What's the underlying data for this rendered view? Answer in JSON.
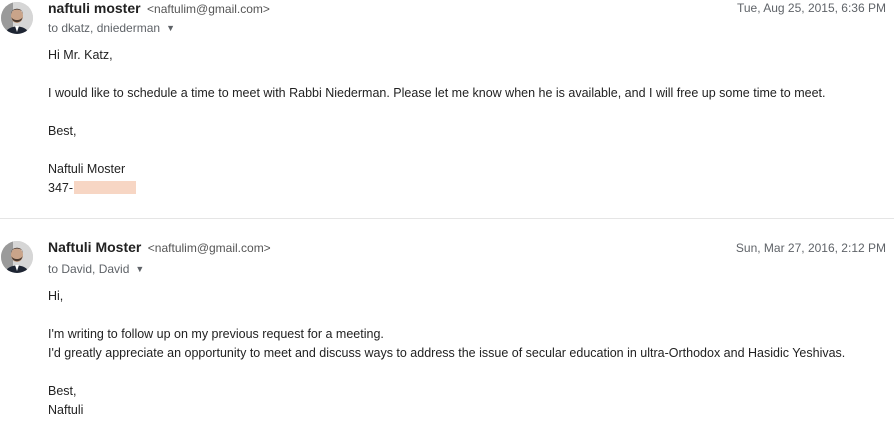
{
  "messages": [
    {
      "sender_name": "naftuli moster",
      "sender_email": "<naftulim@gmail.com>",
      "recipients": "to dkatz, dniederman",
      "timestamp": "Tue, Aug 25, 2015, 6:36 PM",
      "greeting": "Hi Mr. Katz,",
      "paragraph": "I would like to schedule a time to meet with Rabbi Niederman. Please let me know when he is available, and I will free up some time to meet.",
      "closing": "Best,",
      "signature_name": "Naftuli Moster",
      "signature_phone_prefix": "347-"
    },
    {
      "sender_name": "Naftuli Moster",
      "sender_email": "<naftulim@gmail.com>",
      "recipients": "to David, David",
      "timestamp": "Sun, Mar 27, 2016, 2:12 PM",
      "greeting": "Hi,",
      "line1": "I'm writing to follow up on my previous request for a meeting.",
      "line2": "I'd greatly appreciate an opportunity to meet and discuss ways to address the issue of secular education in ultra-Orthodox and Hasidic Yeshivas.",
      "closing": "Best,",
      "signature_name": "Naftuli"
    }
  ],
  "icons": {
    "caret": "chevron-down-icon",
    "avatar": "avatar-photo"
  }
}
